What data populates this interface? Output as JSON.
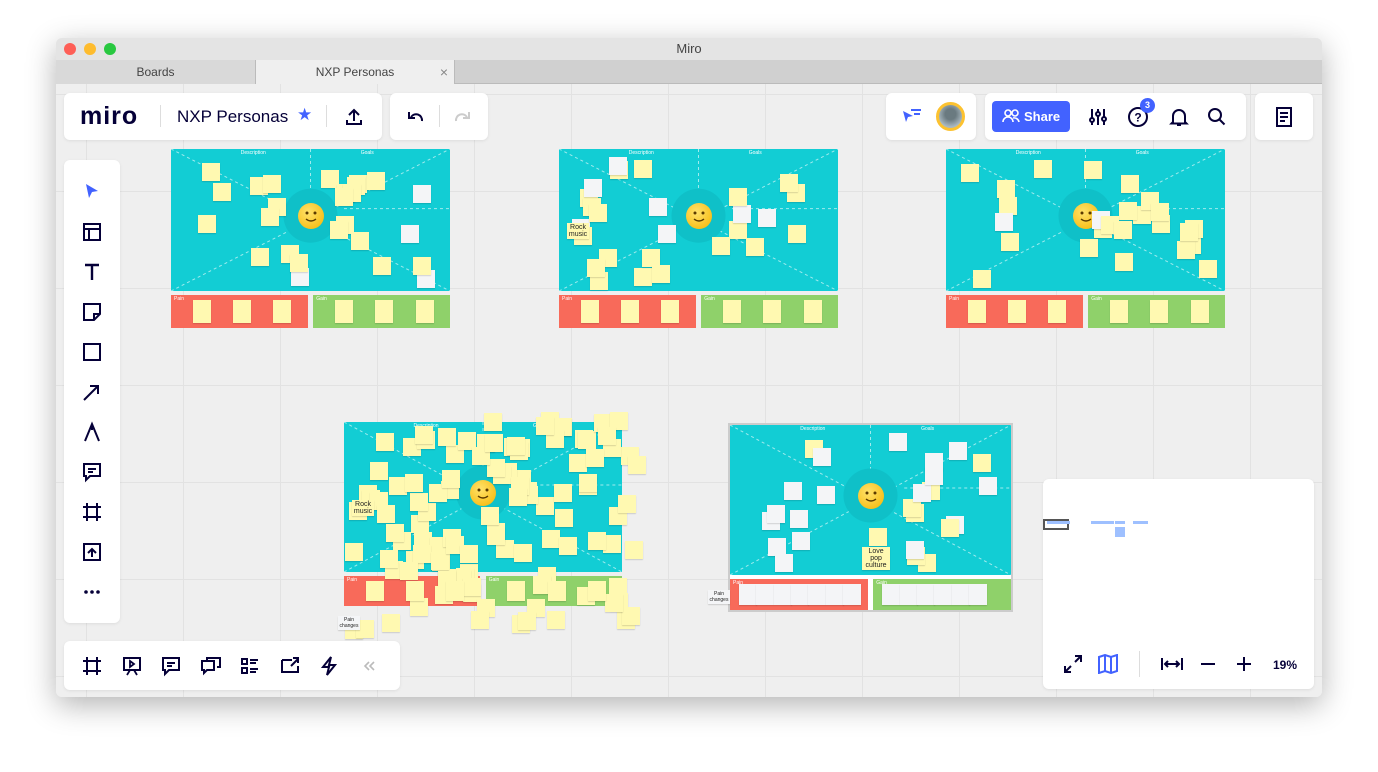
{
  "window": {
    "title": "Miro"
  },
  "tabs": [
    {
      "label": "Boards",
      "active": false
    },
    {
      "label": "NXP Personas",
      "active": true
    }
  ],
  "header": {
    "logo": "miro",
    "board_name": "NXP Personas",
    "starred": true,
    "share_label": "Share",
    "help_badge": "3"
  },
  "colors": {
    "accent": "#4262ff",
    "teal": "#12cdd4",
    "pain": "#f86a5a",
    "gain": "#8fd16a",
    "sticky": "#fff9b1"
  },
  "left_toolbar": [
    "select",
    "templates",
    "text",
    "sticky-note",
    "shape",
    "arrow",
    "pen",
    "comment",
    "frame",
    "upload",
    "more"
  ],
  "bottom_toolbar": [
    "frames",
    "presentation",
    "comments",
    "chat",
    "card",
    "screen-share",
    "activity",
    "collapse"
  ],
  "boards": [
    {
      "labels": {
        "description": "Description",
        "goals": "Goals",
        "pain": "Pain",
        "gain": "Gain"
      }
    },
    {
      "labels": {
        "description": "Description",
        "goals": "Goals",
        "pain": "Pain",
        "gain": "Gain"
      },
      "highlight": "Rock music"
    },
    {
      "labels": {
        "description": "Description",
        "goals": "Goals",
        "pain": "Pain",
        "gain": "Gain"
      }
    },
    {
      "labels": {
        "description": "Description",
        "goals": "Goals",
        "pain": "Pain",
        "gain": "Gain"
      },
      "highlight": "Rock music",
      "extra": "Pain changes"
    },
    {
      "labels": {
        "description": "Description",
        "goals": "Goals",
        "pain": "Pain",
        "gain": "Gain"
      },
      "highlight": "Love pop culture",
      "extra": "Pain changes"
    }
  ],
  "zoom": {
    "level": "19%"
  }
}
